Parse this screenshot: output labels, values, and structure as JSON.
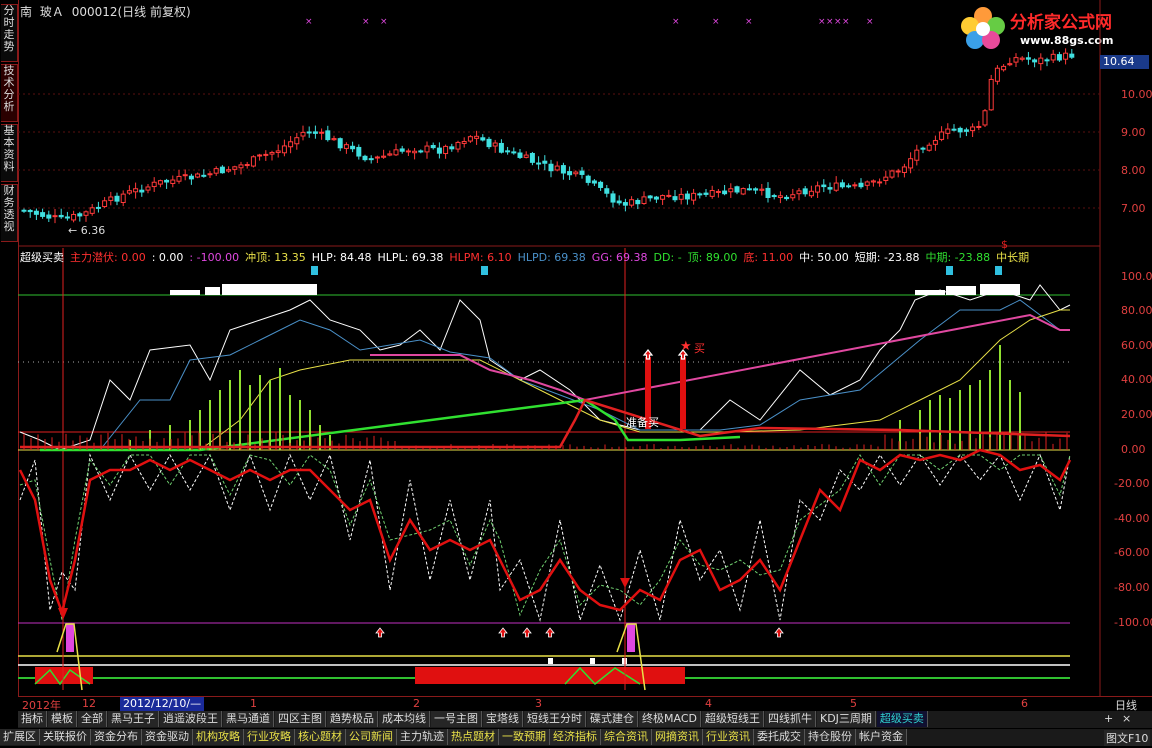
{
  "title": {
    "market": "南",
    "name": "玻Ａ",
    "code": "000012",
    "mode": "(日线 前复权)"
  },
  "logo": {
    "text": "分析家公式网",
    "url": "www.88gs.com"
  },
  "left_tabs": [
    "分时走势",
    "技术分析",
    "基本资料",
    "财务透视"
  ],
  "price_axis": [
    "10.00",
    "9.00",
    "8.00",
    "7.00"
  ],
  "price_tag": "10.64",
  "low_marker": "← 6.36",
  "indicator_header": [
    {
      "text": "超级买卖",
      "color": "#ffffff"
    },
    {
      "text": "主力潜伏: 0.00",
      "color": "#ff3030"
    },
    {
      "text": ": 0.00",
      "color": "#ffffff"
    },
    {
      "text": ": -100.00",
      "color": "#e048e0"
    },
    {
      "text": "冲顶: 13.35",
      "color": "#e8e048"
    },
    {
      "text": "HLP: 84.48",
      "color": "#ffffff"
    },
    {
      "text": "HLPL: 69.38",
      "color": "#ffffff"
    },
    {
      "text": "HLPM: 6.10",
      "color": "#ff3030"
    },
    {
      "text": "HLPD: 69.38",
      "color": "#4a90c8"
    },
    {
      "text": "GG: 69.38",
      "color": "#e048e0"
    },
    {
      "text": "DD: -",
      "color": "#30e030"
    },
    {
      "text": "顶: 89.00",
      "color": "#30e030"
    },
    {
      "text": "底: 11.00",
      "color": "#ff3030"
    },
    {
      "text": "中: 50.00",
      "color": "#ffffff"
    },
    {
      "text": "短期: -23.88",
      "color": "#ffffff"
    },
    {
      "text": "中期: -23.88",
      "color": "#30e030"
    },
    {
      "text": "中长期",
      "color": "#e8e048"
    }
  ],
  "ind_axis": [
    "100.00",
    "80.00",
    "60.00",
    "40.00",
    "20.00",
    "0.00",
    "-20.00",
    "-40.00",
    "-60.00",
    "-80.00",
    "-100.00"
  ],
  "annotations": {
    "buy": "买",
    "prepare_buy": "准备买"
  },
  "date_bar": {
    "year": "2012年",
    "m12": "12",
    "cursor": "2012/12/10/—",
    "m1": "1",
    "m2": "2",
    "m3": "3",
    "m4": "4",
    "m5": "5",
    "m6": "6"
  },
  "daily": "日线",
  "tabs_row1": [
    "指标",
    "模板",
    "全部",
    "黑马王子",
    "逍遥波段王",
    "黑马通道",
    "四区主图",
    "趋势极品",
    "成本均线",
    "一号主图",
    "宝塔线",
    "短线王分时",
    "碟式建仓",
    "终极MACD",
    "超级短线王",
    "四线抓牛",
    "KDJ三周期",
    "超级买卖"
  ],
  "tabs_row1_active": 17,
  "tabs_row2": [
    "扩展区",
    "关联报价",
    "资金分布",
    "资金驱动",
    "机构攻略",
    "行业攻略",
    "核心题材",
    "公司新闻",
    "主力轨迹",
    "热点题材",
    "一致预期",
    "经济指标",
    "综合资讯",
    "网摘资讯",
    "行业资讯",
    "委托成交",
    "持仓股份",
    "帐户资金"
  ],
  "tabs_row2_hl": [
    4,
    5,
    6,
    7,
    9,
    10,
    11,
    12,
    13,
    14
  ],
  "right_controls": [
    "+",
    "×",
    "图文F10"
  ]
}
